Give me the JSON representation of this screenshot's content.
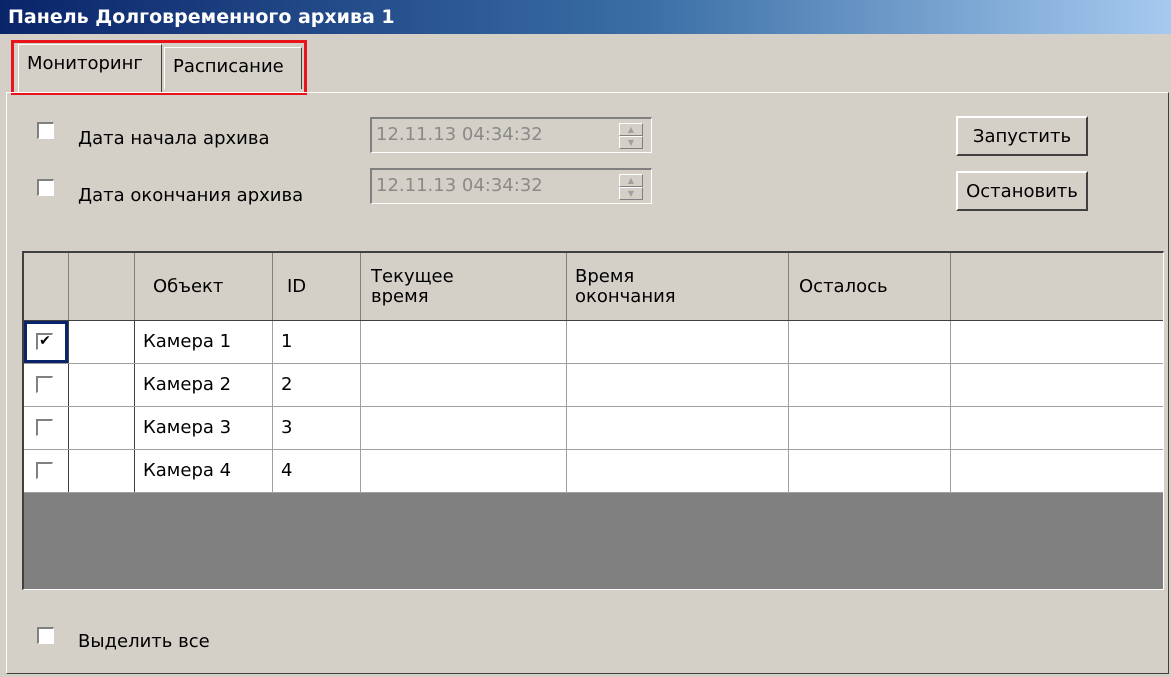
{
  "window": {
    "title": "Панель Долговременного архива 1"
  },
  "tabs": [
    {
      "label": "Мониторинг",
      "active": true
    },
    {
      "label": "Расписание",
      "active": false
    }
  ],
  "archive": {
    "start": {
      "label": "Дата начала архива",
      "checked": false,
      "value": "12.11.13 04:34:32"
    },
    "end": {
      "label": "Дата окончания архива",
      "checked": false,
      "value": "12.11.13 04:34:32"
    }
  },
  "buttons": {
    "start": "Запустить",
    "stop": "Остановить"
  },
  "table": {
    "columns": [
      "",
      "",
      "Объект",
      "ID",
      "Текущее время",
      "Время окончания",
      "Осталось",
      ""
    ],
    "rows": [
      {
        "checked": true,
        "object": "Камера 1",
        "id": "1",
        "current": "",
        "end": "",
        "remaining": ""
      },
      {
        "checked": false,
        "object": "Камера 2",
        "id": "2",
        "current": "",
        "end": "",
        "remaining": ""
      },
      {
        "checked": false,
        "object": "Камера 3",
        "id": "3",
        "current": "",
        "end": "",
        "remaining": ""
      },
      {
        "checked": false,
        "object": "Камера 4",
        "id": "4",
        "current": "",
        "end": "",
        "remaining": ""
      }
    ]
  },
  "select_all": {
    "label": "Выделить все",
    "checked": false
  },
  "colors": {
    "highlight_frame": "#e8141c",
    "title_gradient_start": "#0a246a",
    "window_bg": "#d4d0c8",
    "grid_empty": "#808080"
  }
}
